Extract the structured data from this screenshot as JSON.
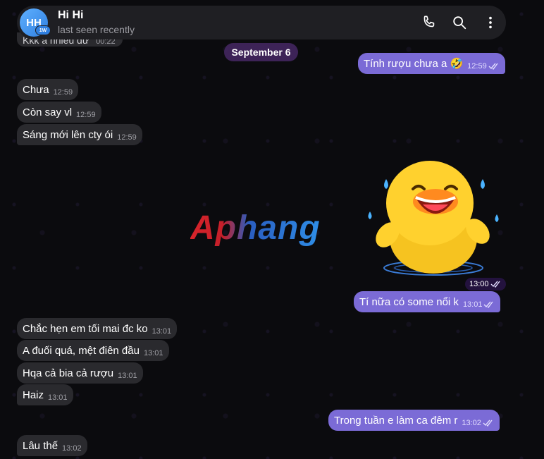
{
  "header": {
    "avatar_initials": "HH",
    "avatar_badge": "1W",
    "title": "Hi Hi",
    "status": "last seen recently",
    "icons": [
      "phone-icon",
      "search-icon",
      "more-icon"
    ]
  },
  "partial_message": {
    "text": "Kkk a nhiều dứ",
    "time": "00:22"
  },
  "date_separator": "September 6",
  "messages": [
    {
      "dir": "out",
      "text": "Tính rượu chưa a 🤣",
      "time": "12:59"
    },
    {
      "dir": "in",
      "text": "Chưa",
      "time": "12:59"
    },
    {
      "dir": "in",
      "text": "Còn say vl",
      "time": "12:59"
    },
    {
      "dir": "in",
      "text": "Sáng mới lên cty ói",
      "time": "12:59"
    },
    {
      "dir": "out",
      "text": "Tí nữa có some nổi k",
      "time": "13:01"
    },
    {
      "dir": "in",
      "text": "Chắc hẹn em tối mai đc ko",
      "time": "13:01"
    },
    {
      "dir": "in",
      "text": "A đuối quá, mệt điên đầu",
      "time": "13:01"
    },
    {
      "dir": "in",
      "text": "Hqa cả bia cả rượu",
      "time": "13:01"
    },
    {
      "dir": "in",
      "text": "Haiz",
      "time": "13:01"
    },
    {
      "dir": "out",
      "text": "Trong tuần e làm ca đêm r",
      "time": "13:02"
    },
    {
      "dir": "in",
      "text": "Lâu thế",
      "time": "13:02"
    }
  ],
  "sticker": {
    "name": "laughing-duck-sticker",
    "time": "13:00"
  },
  "watermark": "Aphang",
  "colors": {
    "incoming": "#2a2a2e",
    "outgoing": "#7b6bd6",
    "header": "#1f1f23",
    "date_pill": "#46286a"
  }
}
